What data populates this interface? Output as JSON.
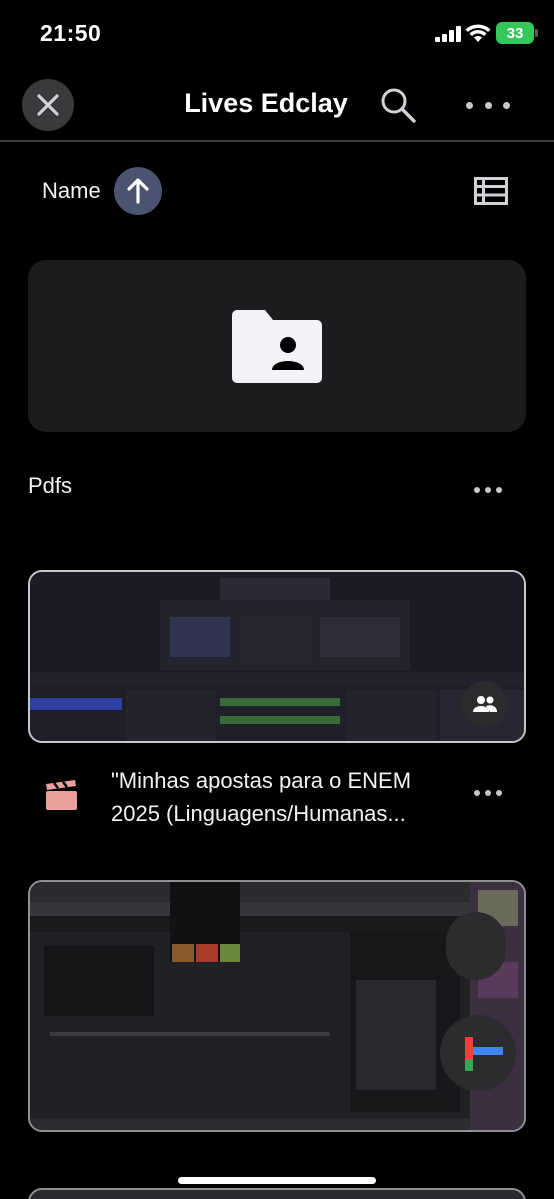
{
  "status": {
    "time": "21:50",
    "battery": "33"
  },
  "header": {
    "title": "Lives Edclay",
    "close_icon": "close-icon",
    "search_icon": "search-icon",
    "more_icon": "more-icon"
  },
  "sort": {
    "label": "Name",
    "direction_icon": "arrow-up-icon",
    "view_icon": "list-view-icon"
  },
  "items": [
    {
      "type": "folder",
      "title": "Pdfs",
      "icon": "shared-folder-icon"
    },
    {
      "type": "video",
      "title_line1": "\"Minhas apostas para o ENEM",
      "title_line2": "2025 (Linguagens/Humanas...",
      "icon": "clapperboard-icon",
      "badge": "shared-icon"
    }
  ],
  "colors": {
    "background": "#000000",
    "card": "#1c1c1e",
    "accent": "#4a5470",
    "video_icon": "#e8a09a"
  }
}
